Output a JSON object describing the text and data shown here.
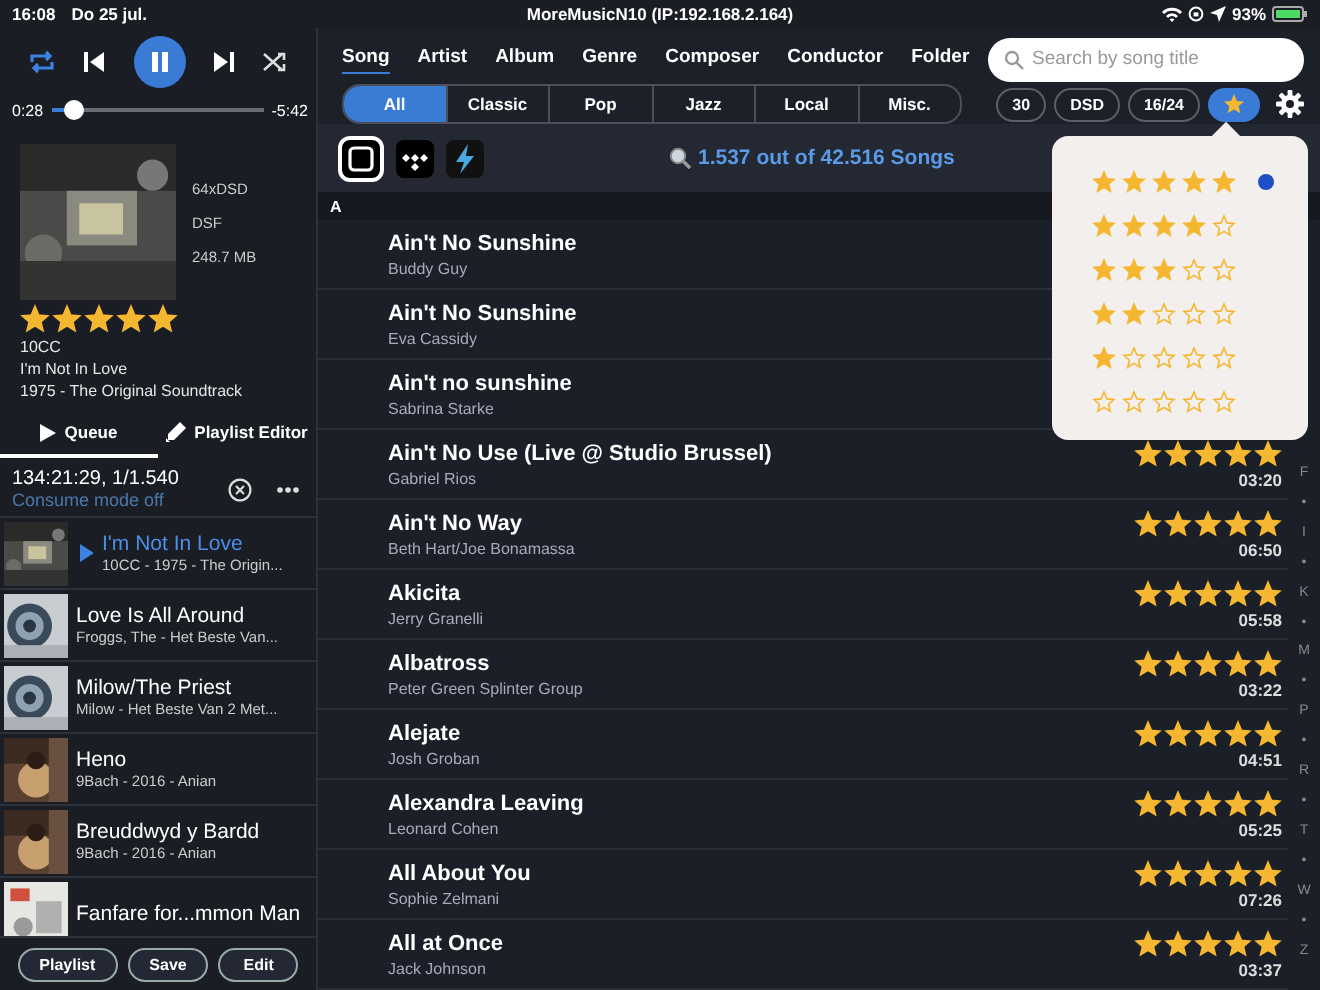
{
  "status_bar": {
    "time": "16:08",
    "date": "Do 25 jul.",
    "title": "MoreMusicN10 (IP:192.168.2.164)",
    "battery": "93%"
  },
  "player": {
    "repeat": true,
    "shuffle": false,
    "playing": true,
    "elapsed": "0:28",
    "remaining": "-5:42",
    "level": 0.11
  },
  "now_playing": {
    "format": "64xDSD",
    "type": "DSF",
    "size": "248.7 MB",
    "stars": 5,
    "artist": "10CC",
    "title": "I'm Not In Love",
    "album": "1975 - The Original Soundtrack"
  },
  "panel_tabs": [
    {
      "kind": "queue",
      "label": "Queue",
      "selected": true
    },
    {
      "kind": "editor",
      "label": "Playlist Editor",
      "selected": false
    }
  ],
  "queue": {
    "summary": "134:21:29, 1/1.540",
    "consume": "Consume mode off",
    "items": [
      {
        "title": "I'm Not In Love",
        "subtitle": "10CC - 1975 - The Origin...",
        "playing": true
      },
      {
        "title": "Love Is All Around",
        "subtitle": "Froggs, The - Het Beste Van...",
        "playing": false
      },
      {
        "title": "Milow/The Priest",
        "subtitle": "Milow - Het Beste Van 2 Met...",
        "playing": false
      },
      {
        "title": "Heno",
        "subtitle": "9Bach - 2016 - Anian",
        "playing": false
      },
      {
        "title": "Breuddwyd y Bardd",
        "subtitle": "9Bach - 2016 - Anian",
        "playing": false
      },
      {
        "title": "Fanfare for...mmon Man",
        "playing": false
      }
    ]
  },
  "queue_buttons": [
    "Playlist",
    "Save",
    "Edit"
  ],
  "browse_tabs": [
    {
      "label": "Song",
      "selected": true
    },
    {
      "label": "Artist",
      "selected": false
    },
    {
      "label": "Album",
      "selected": false
    },
    {
      "label": "Genre",
      "selected": false
    },
    {
      "label": "Composer",
      "selected": false
    },
    {
      "label": "Conductor",
      "selected": false
    },
    {
      "label": "Folder",
      "selected": false
    }
  ],
  "search": {
    "placeholder": "Search by song title"
  },
  "categories": [
    {
      "label": "All",
      "selected": true
    },
    {
      "label": "Classic",
      "selected": false
    },
    {
      "label": "Pop",
      "selected": false
    },
    {
      "label": "Jazz",
      "selected": false
    },
    {
      "label": "Local",
      "selected": false
    },
    {
      "label": "Misc.",
      "selected": false
    }
  ],
  "filters": [
    {
      "kind": "text",
      "label": "30",
      "selected": false
    },
    {
      "kind": "text",
      "label": "DSD",
      "selected": false
    },
    {
      "kind": "text",
      "label": "16/24",
      "selected": false
    },
    {
      "kind": "star",
      "selected": true
    }
  ],
  "count": "1.537 out of 42.516 Songs",
  "section": "A",
  "songs": [
    {
      "title": "Ain't No Sunshine",
      "artist": "Buddy Guy"
    },
    {
      "title": "Ain't No Sunshine",
      "artist": "Eva Cassidy"
    },
    {
      "title": "Ain't no sunshine",
      "artist": "Sabrina Starke"
    },
    {
      "title": "Ain't No Use (Live @ Studio Brussel)",
      "artist": "Gabriel Rios",
      "stars": 5,
      "duration": "03:20"
    },
    {
      "title": "Ain't No Way",
      "artist": "Beth Hart/Joe Bonamassa",
      "stars": 5,
      "duration": "06:50"
    },
    {
      "title": "Akicita",
      "artist": "Jerry Granelli",
      "stars": 5,
      "duration": "05:58"
    },
    {
      "title": "Albatross",
      "artist": "Peter Green Splinter Group",
      "stars": 5,
      "duration": "03:22"
    },
    {
      "title": "Alejate",
      "artist": "Josh Groban",
      "stars": 5,
      "duration": "04:51"
    },
    {
      "title": "Alexandra Leaving",
      "artist": "Leonard Cohen",
      "stars": 5,
      "duration": "05:25"
    },
    {
      "title": "All About You",
      "artist": "Sophie Zelmani",
      "stars": 5,
      "duration": "07:26"
    },
    {
      "title": "All at Once",
      "artist": "Jack Johnson",
      "stars": 5,
      "duration": "03:37"
    }
  ],
  "index": [
    "F",
    "•",
    "I",
    "•",
    "K",
    "•",
    "M",
    "•",
    "P",
    "•",
    "R",
    "•",
    "T",
    "•",
    "W",
    "•",
    "Z"
  ],
  "rating_menu": [
    {
      "stars": 5,
      "selected": true
    },
    {
      "stars": 4,
      "selected": false
    },
    {
      "stars": 3,
      "selected": false
    },
    {
      "stars": 2,
      "selected": false
    },
    {
      "stars": 1,
      "selected": false
    },
    {
      "stars": 0,
      "selected": false
    }
  ]
}
